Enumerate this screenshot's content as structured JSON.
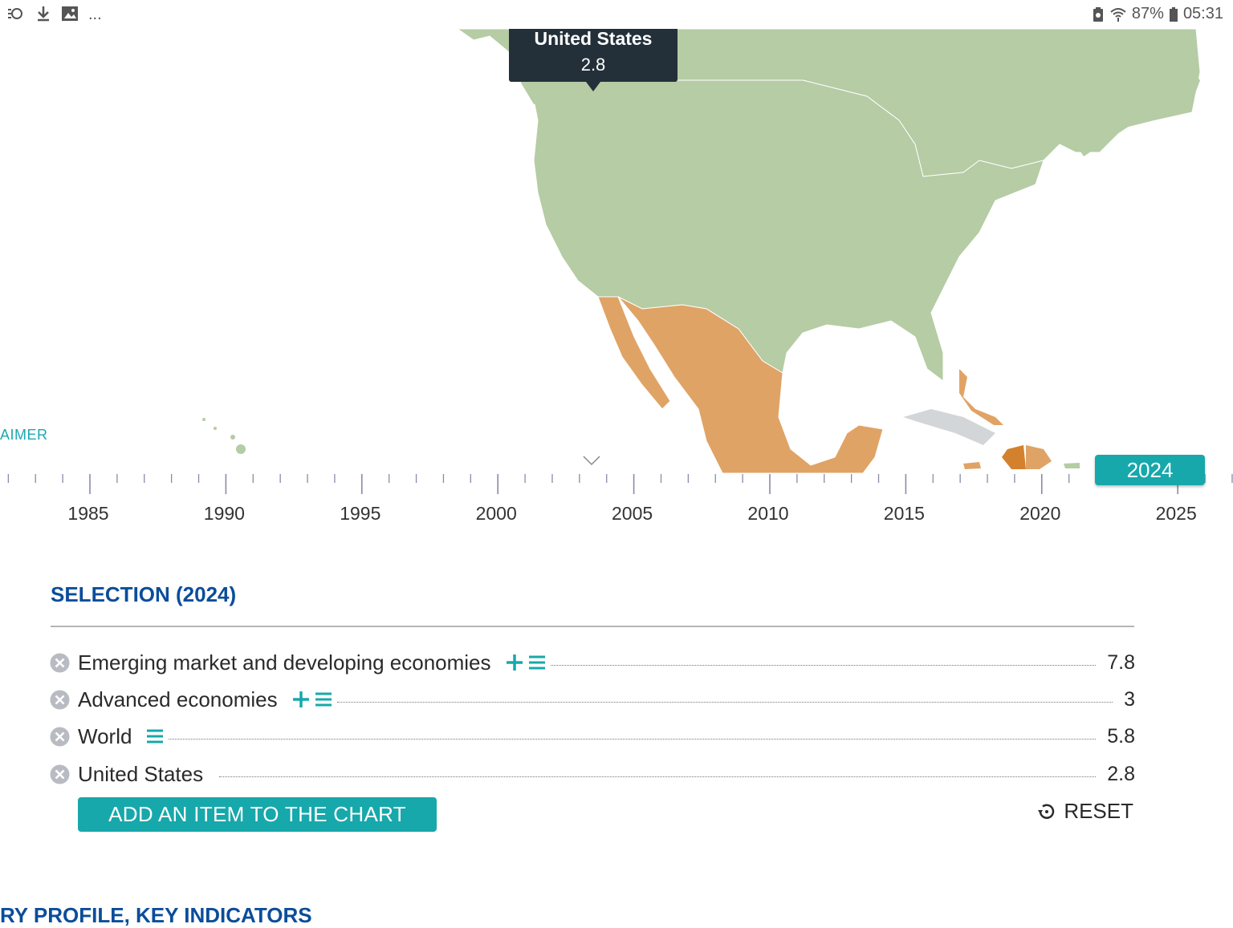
{
  "status_bar": {
    "battery_percent": "87%",
    "time": "05:31"
  },
  "map": {
    "tooltip": {
      "country": "United States",
      "value": "2.8"
    },
    "disclaimer_partial": "AIMER",
    "colors": {
      "low": "#b5cca4",
      "high": "#e0a366",
      "highest": "#d4812e",
      "no_data": "#d3d6d8"
    }
  },
  "timeline": {
    "labels": [
      "1985",
      "1990",
      "1995",
      "2000",
      "2005",
      "2010",
      "2015",
      "2020",
      "2025"
    ],
    "selected_year": "2024"
  },
  "selection": {
    "title": "SELECTION (2024)",
    "rows": [
      {
        "label": "Emerging market and developing economies",
        "value": "7.8"
      },
      {
        "label": "Advanced economies",
        "value": "3"
      },
      {
        "label": "World",
        "value": "5.8"
      },
      {
        "label": "United States",
        "value": "2.8"
      }
    ],
    "add_button": "ADD AN ITEM TO THE CHART",
    "reset": "RESET"
  },
  "next_section_title": "RY PROFILE, KEY INDICATORS"
}
